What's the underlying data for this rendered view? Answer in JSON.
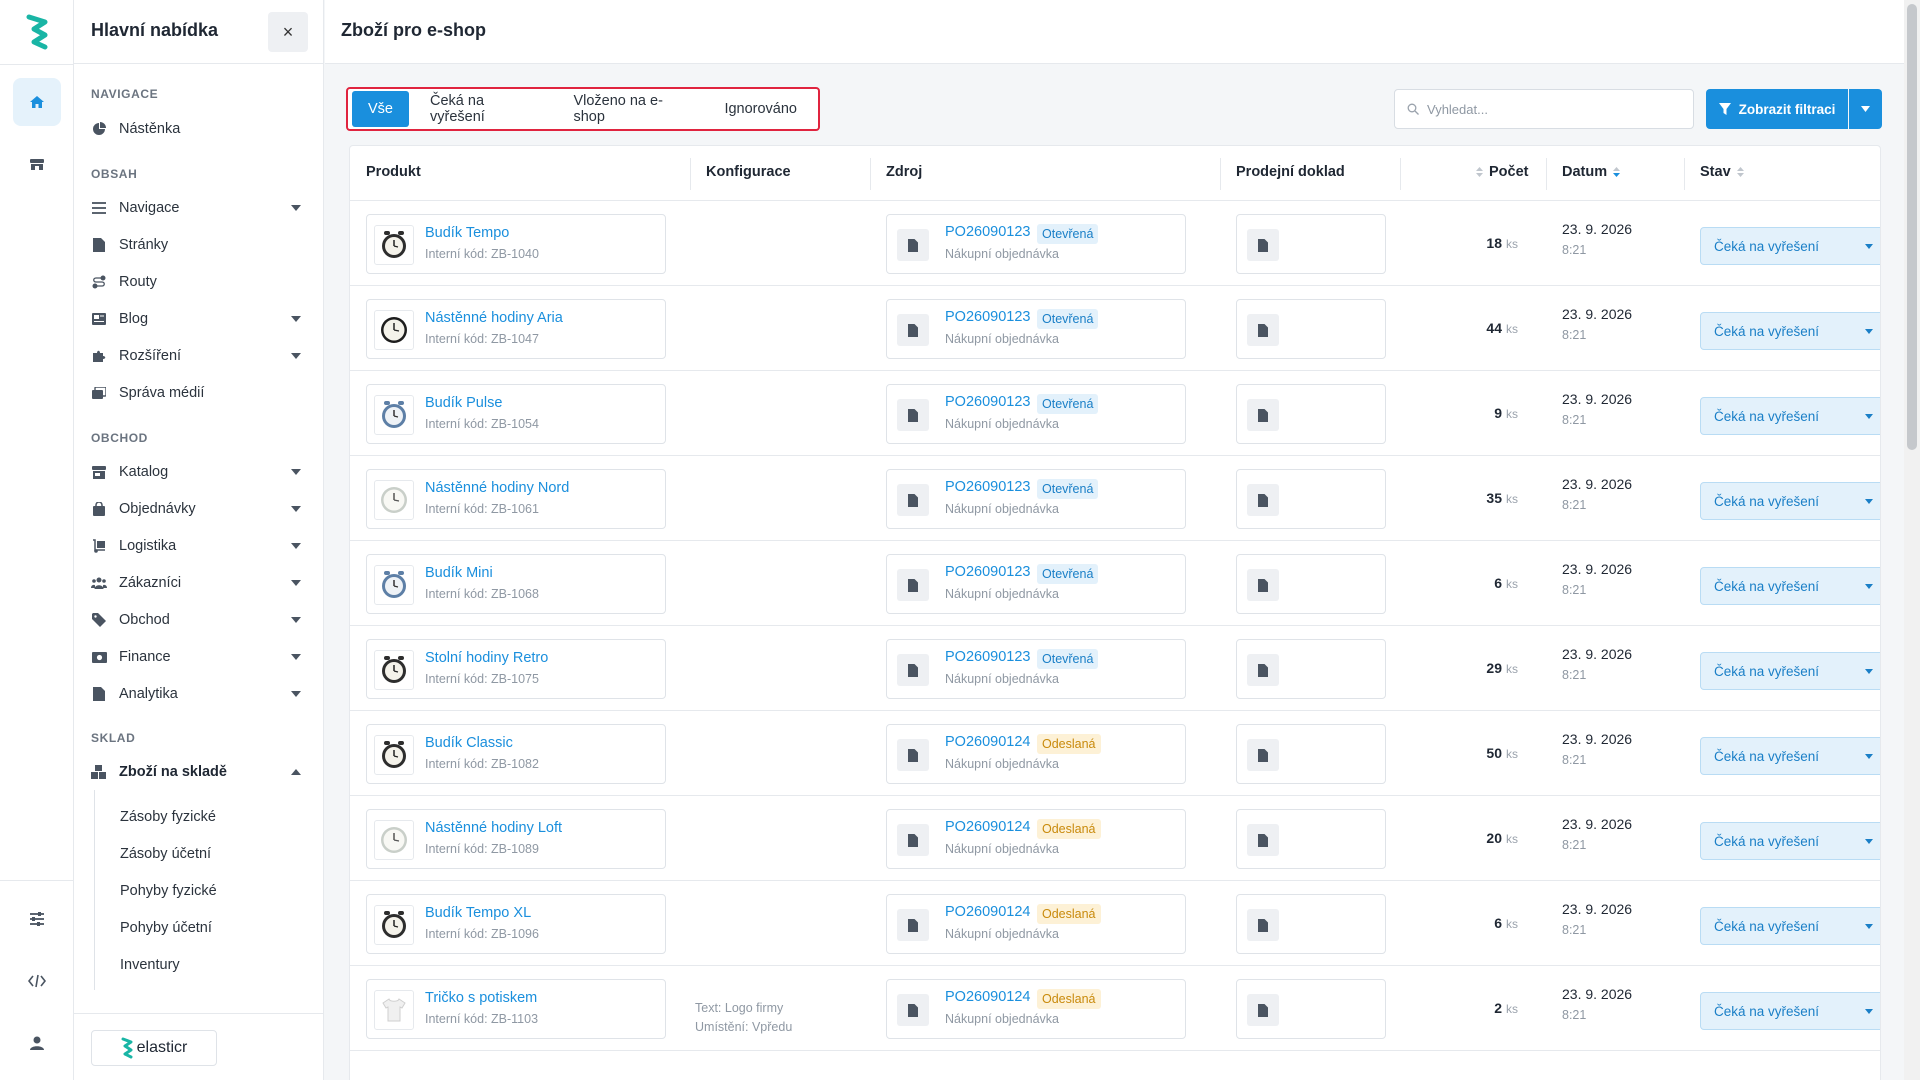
{
  "app": {
    "brand": "elasticr"
  },
  "sidebar": {
    "title": "Hlavní nabídka",
    "close_label": "×",
    "sections": {
      "navigace": "NAVIGACE",
      "obsah": "OBSAH",
      "obchod": "OBCHOD",
      "sklad": "SKLAD"
    },
    "items": {
      "nastenka": "Nástěnka",
      "navigace": "Navigace",
      "stranky": "Stránky",
      "routy": "Routy",
      "blog": "Blog",
      "rozsireni": "Rozšíření",
      "sprava_medii": "Správa médií",
      "katalog": "Katalog",
      "objednavky": "Objednávky",
      "logistika": "Logistika",
      "zakaznici": "Zákazníci",
      "obchod": "Obchod",
      "finance": "Finance",
      "analytika": "Analytika",
      "zbozi_na_sklade": "Zboží na skladě"
    },
    "subitems": [
      "Zásoby fyzické",
      "Zásoby účetní",
      "Pohyby fyzické",
      "Pohyby účetní",
      "Inventury"
    ]
  },
  "page": {
    "title": "Zboží pro e-shop",
    "tabs": [
      "Vše",
      "Čeká na vyřešení",
      "Vloženo na e-shop",
      "Ignorováno"
    ],
    "active_tab": "Vše",
    "search_placeholder": "Vyhledat...",
    "filter_button": "Zobrazit filtraci"
  },
  "table": {
    "columns": {
      "produkt": "Produkt",
      "konfigurace": "Konfigurace",
      "zdroj": "Zdroj",
      "prodejni_doklad": "Prodejní doklad",
      "pocet": "Počet",
      "datum": "Datum",
      "stav": "Stav"
    },
    "unit": "ks",
    "rows": [
      {
        "name": "Budík Tempo",
        "code": "Interní kód: ZB-1040",
        "config1": "",
        "config2": "",
        "source": "PO26090123",
        "badge": "Otevřená",
        "badge_type": "open",
        "source_type": "Nákupní objednávka",
        "qty": "18",
        "date": "23. 9. 2026",
        "time": "8:21",
        "status": "Čeká na vyřešení",
        "thumb": "alarm-dark"
      },
      {
        "name": "Nástěnné hodiny Aria",
        "code": "Interní kód: ZB-1047",
        "config1": "",
        "config2": "",
        "source": "PO26090123",
        "badge": "Otevřená",
        "badge_type": "open",
        "source_type": "Nákupní objednávka",
        "qty": "44",
        "date": "23. 9. 2026",
        "time": "8:21",
        "status": "Čeká na vyřešení",
        "thumb": "wall-dark"
      },
      {
        "name": "Budík Pulse",
        "code": "Interní kód: ZB-1054",
        "config1": "",
        "config2": "",
        "source": "PO26090123",
        "badge": "Otevřená",
        "badge_type": "open",
        "source_type": "Nákupní objednávka",
        "qty": "9",
        "date": "23. 9. 2026",
        "time": "8:21",
        "status": "Čeká na vyřešení",
        "thumb": "alarm-blue"
      },
      {
        "name": "Nástěnné hodiny Nord",
        "code": "Interní kód: ZB-1061",
        "config1": "",
        "config2": "",
        "source": "PO26090123",
        "badge": "Otevřená",
        "badge_type": "open",
        "source_type": "Nákupní objednávka",
        "qty": "35",
        "date": "23. 9. 2026",
        "time": "8:21",
        "status": "Čeká na vyřešení",
        "thumb": "wall-light"
      },
      {
        "name": "Budík Mini",
        "code": "Interní kód: ZB-1068",
        "config1": "",
        "config2": "",
        "source": "PO26090123",
        "badge": "Otevřená",
        "badge_type": "open",
        "source_type": "Nákupní objednávka",
        "qty": "6",
        "date": "23. 9. 2026",
        "time": "8:21",
        "status": "Čeká na vyřešení",
        "thumb": "alarm-blue"
      },
      {
        "name": "Stolní hodiny Retro",
        "code": "Interní kód: ZB-1075",
        "config1": "",
        "config2": "",
        "source": "PO26090123",
        "badge": "Otevřená",
        "badge_type": "open",
        "source_type": "Nákupní objednávka",
        "qty": "29",
        "date": "23. 9. 2026",
        "time": "8:21",
        "status": "Čeká na vyřešení",
        "thumb": "alarm-dark"
      },
      {
        "name": "Budík Classic",
        "code": "Interní kód: ZB-1082",
        "config1": "",
        "config2": "",
        "source": "PO26090124",
        "badge": "Odeslaná",
        "badge_type": "sent",
        "source_type": "Nákupní objednávka",
        "qty": "50",
        "date": "23. 9. 2026",
        "time": "8:21",
        "status": "Čeká na vyřešení",
        "thumb": "alarm-dark"
      },
      {
        "name": "Nástěnné hodiny Loft",
        "code": "Interní kód: ZB-1089",
        "config1": "",
        "config2": "",
        "source": "PO26090124",
        "badge": "Odeslaná",
        "badge_type": "sent",
        "source_type": "Nákupní objednávka",
        "qty": "20",
        "date": "23. 9. 2026",
        "time": "8:21",
        "status": "Čeká na vyřešení",
        "thumb": "wall-light"
      },
      {
        "name": "Budík Tempo XL",
        "code": "Interní kód: ZB-1096",
        "config1": "",
        "config2": "",
        "source": "PO26090124",
        "badge": "Odeslaná",
        "badge_type": "sent",
        "source_type": "Nákupní objednávka",
        "qty": "6",
        "date": "23. 9. 2026",
        "time": "8:21",
        "status": "Čeká na vyřešení",
        "thumb": "alarm-dark"
      },
      {
        "name": "Tričko s potiskem",
        "code": "Interní kód: ZB-1103",
        "config1": "Text: Logo firmy",
        "config2": "Umístění: Vpředu",
        "source": "PO26090124",
        "badge": "Odeslaná",
        "badge_type": "sent",
        "source_type": "Nákupní objednávka",
        "qty": "2",
        "date": "23. 9. 2026",
        "time": "8:21",
        "status": "Čeká na vyřešení",
        "thumb": "tshirt"
      }
    ]
  }
}
